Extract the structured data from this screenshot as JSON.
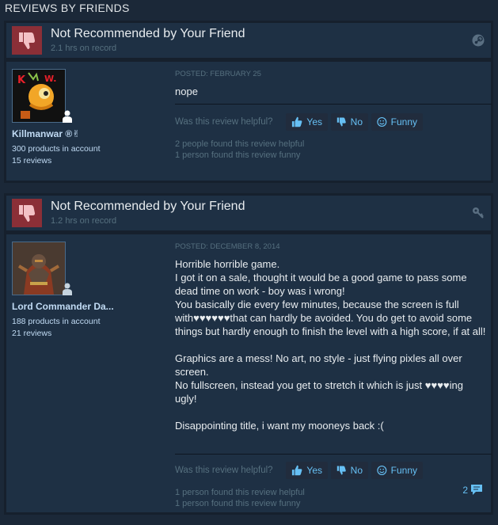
{
  "section_title": "REVIEWS BY FRIENDS",
  "reviews": [
    {
      "verdict": "Not Recommended by Your Friend",
      "hours": "2.1 hrs on record",
      "author": "Killmanwar ®✌",
      "products": "300 products in account",
      "review_count": "15 reviews",
      "posted": "POSTED: FEBRUARY 25",
      "text": "nope",
      "helpful_question": "Was this review helpful?",
      "yes_label": "Yes",
      "no_label": "No",
      "funny_label": "Funny",
      "found_helpful": "2 people found this review helpful",
      "found_funny": "1 person found this review funny"
    },
    {
      "verdict": "Not Recommended by Your Friend",
      "hours": "1.2 hrs on record",
      "author": "Lord Commander Da...",
      "products": "188 products in account",
      "review_count": "21 reviews",
      "posted": "POSTED: DECEMBER 8, 2014",
      "text": "Horrible horrible game.\nI got it on a sale, thought it would be a good game to pass some dead time on work - boy was i wrong!\nYou basically die every few minutes, because the screen is full with♥♥♥♥♥♥that can hardly be avoided. You do get to avoid some things but hardly enough to finish the level with a high score, if at all!\n\nGraphics are a mess! No art, no style - just flying pixles all over screen.\nNo fullscreen, instead you get to stretch it which is just ♥♥♥♥ing ugly!\n\nDisappointing title, i want my mooneys back :(",
      "helpful_question": "Was this review helpful?",
      "yes_label": "Yes",
      "no_label": "No",
      "funny_label": "Funny",
      "found_helpful": "1 person found this review helpful",
      "found_funny": "1 person found this review funny",
      "comment_count": "2"
    }
  ],
  "colors": {
    "background": "#1b2838",
    "panel": "#1e3044",
    "thumb_down_bg": "#8b2f37",
    "link_blue": "#66c0f4",
    "muted": "#56707f"
  },
  "icons": {
    "verdict": "thumbs-down-icon",
    "head_1": "steam-icon",
    "head_2": "key-icon",
    "yes": "thumbs-up-icon",
    "no": "thumbs-down-icon",
    "funny": "smiley-icon",
    "comment": "comment-bubble-icon"
  }
}
